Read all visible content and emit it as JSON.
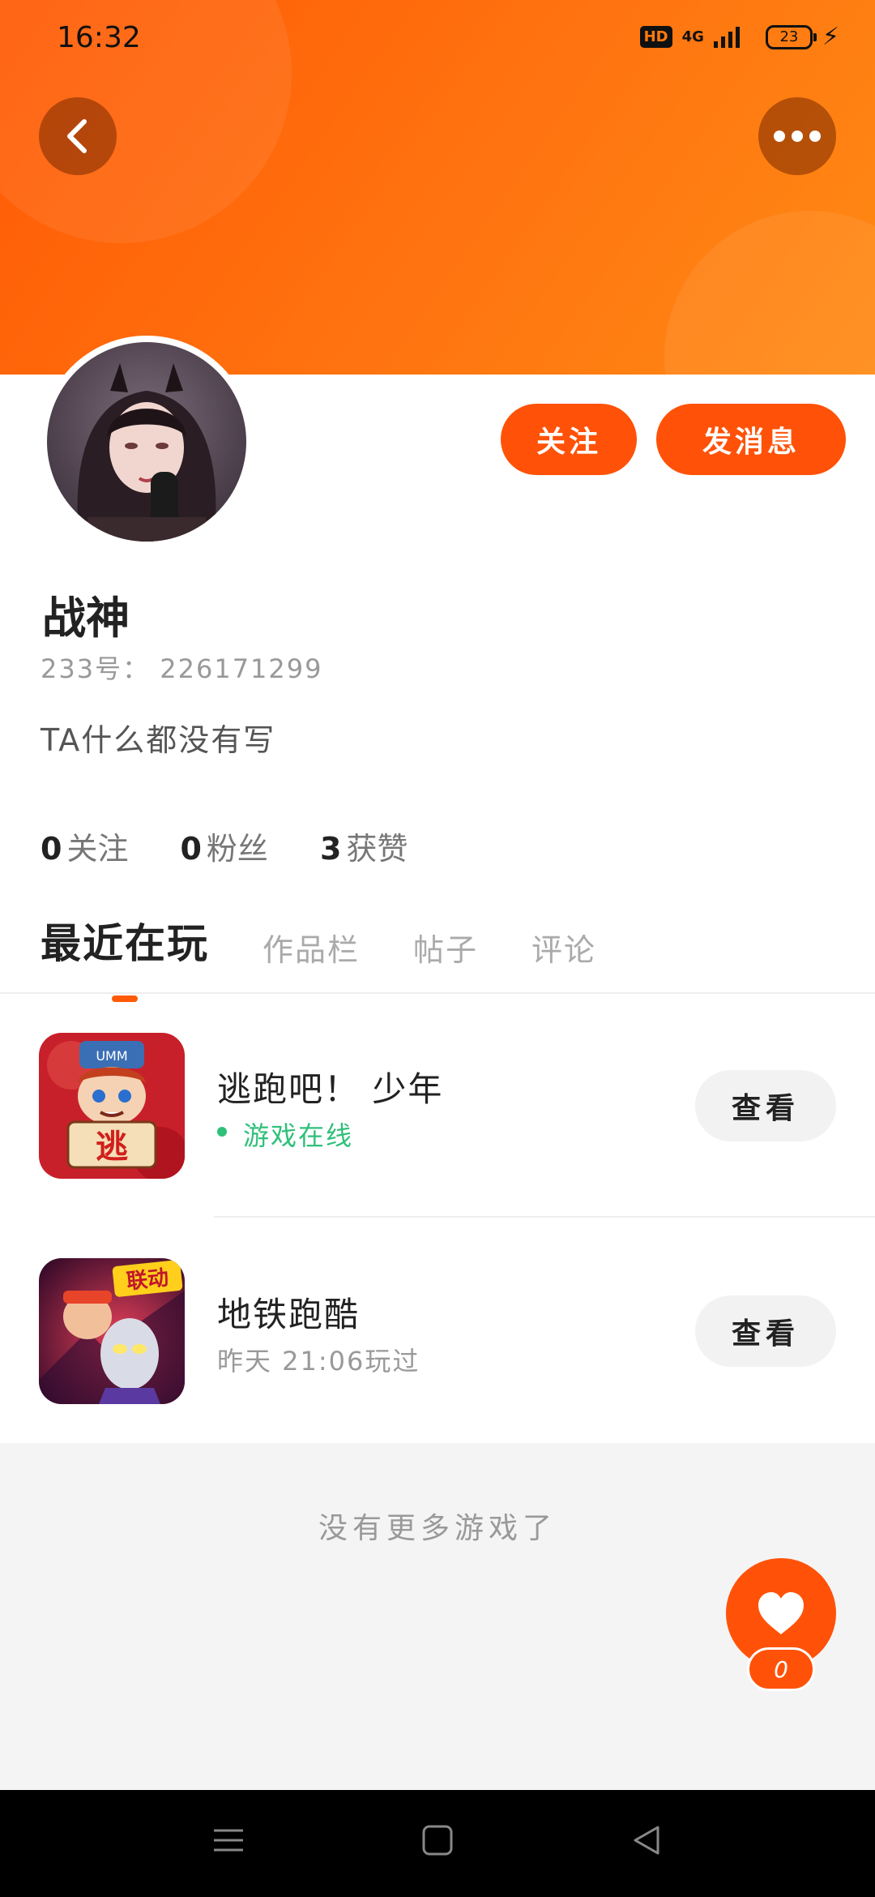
{
  "status_bar": {
    "time": "16:32",
    "hd": "HD",
    "network": "4G",
    "battery": "23"
  },
  "header": {
    "back_icon": "chevron-left-icon",
    "more_icon": "more-dots-icon",
    "gradient_colors": [
      "#ff5a05",
      "#ff8a14"
    ]
  },
  "profile": {
    "name": "战神",
    "uid": "233号： 226171299",
    "bio": "TA什么都没有写",
    "follow_button": "关注",
    "message_button": "发消息",
    "stats": [
      {
        "value": "0",
        "label": "关注"
      },
      {
        "value": "0",
        "label": "粉丝"
      },
      {
        "value": "3",
        "label": "获赞"
      }
    ]
  },
  "tabs": [
    {
      "label": "最近在玩",
      "active": true
    },
    {
      "label": "作品栏",
      "active": false
    },
    {
      "label": "帖子",
      "active": false
    },
    {
      "label": "评论",
      "active": false
    }
  ],
  "games": [
    {
      "title": "逃跑吧！ 少年",
      "subtitle": "游戏在线",
      "button": "查看",
      "icon_label": "逃",
      "icon_badge": "UMM"
    },
    {
      "title": "地铁跑酷",
      "subtitle": "昨天 21:06玩过",
      "button": "查看",
      "icon_label": "联动"
    }
  ],
  "footer": {
    "no_more": "没有更多游戏了",
    "like_count": "0"
  },
  "colors": {
    "accent": "#ff5208",
    "online": "#2fc07a"
  }
}
